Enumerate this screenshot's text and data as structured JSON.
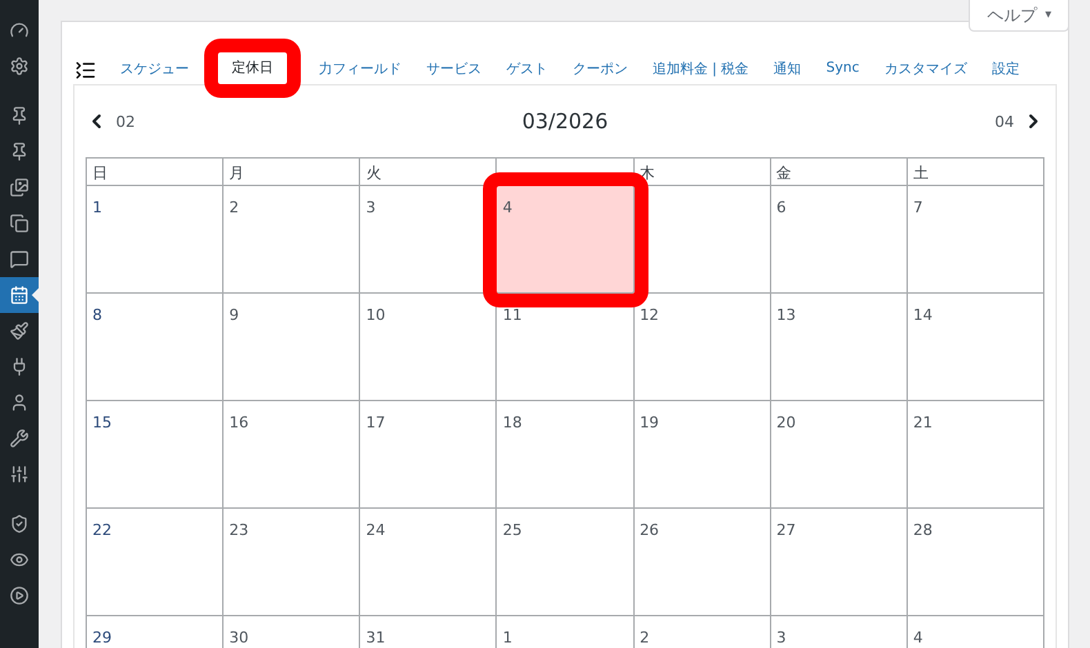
{
  "sidebar": {
    "items": [
      {
        "selected": false
      },
      {
        "selected": false
      },
      {
        "selected": false
      },
      {
        "selected": false
      },
      {
        "selected": false
      },
      {
        "selected": false
      },
      {
        "selected": false
      },
      {
        "selected": true
      },
      {
        "selected": false
      },
      {
        "selected": false
      },
      {
        "selected": false
      },
      {
        "selected": false
      },
      {
        "selected": false
      },
      {
        "selected": false
      },
      {
        "selected": false
      },
      {
        "selected": false
      }
    ]
  },
  "help": {
    "label": "ヘルプ",
    "caret": "▾"
  },
  "tabs": [
    {
      "label": "スケジュー",
      "selected": false,
      "highlighted": false
    },
    {
      "label": "定休日",
      "selected": true,
      "highlighted": true
    },
    {
      "label": "力フィールド",
      "selected": false,
      "highlighted": false
    },
    {
      "label": "サービス",
      "selected": false,
      "highlighted": false
    },
    {
      "label": "ゲスト",
      "selected": false,
      "highlighted": false
    },
    {
      "label": "クーポン",
      "selected": false,
      "highlighted": false
    },
    {
      "label": "追加料金 | 税金",
      "selected": false,
      "highlighted": false
    },
    {
      "label": "通知",
      "selected": false,
      "highlighted": false
    },
    {
      "label": "Sync",
      "selected": false,
      "highlighted": false
    },
    {
      "label": "カスタマイズ",
      "selected": false,
      "highlighted": false
    },
    {
      "label": "設定",
      "selected": false,
      "highlighted": false
    }
  ],
  "calendar": {
    "prev": "02",
    "title": "03/2026",
    "next": "04",
    "weekdays": [
      {
        "label": "日",
        "covered": false
      },
      {
        "label": "月",
        "covered": false
      },
      {
        "label": "火",
        "covered": false
      },
      {
        "covered": true
      },
      {
        "label": "木",
        "covered": false
      },
      {
        "label": "金",
        "covered": false
      },
      {
        "label": "土",
        "covered": false
      }
    ],
    "weeks": [
      [
        {
          "day": "1",
          "highlighted": false
        },
        {
          "day": "2",
          "highlighted": false
        },
        {
          "day": "3",
          "highlighted": false
        },
        {
          "day": "4",
          "highlighted": true
        },
        {
          "highlighted": false
        },
        {
          "day": "6",
          "highlighted": false
        },
        {
          "day": "7",
          "highlighted": false
        }
      ],
      [
        {
          "day": "8",
          "highlighted": false
        },
        {
          "day": "9",
          "highlighted": false
        },
        {
          "day": "10",
          "highlighted": false
        },
        {
          "day": "11",
          "highlighted": false
        },
        {
          "day": "12",
          "highlighted": false
        },
        {
          "day": "13",
          "highlighted": false
        },
        {
          "day": "14",
          "highlighted": false
        }
      ],
      [
        {
          "day": "15",
          "highlighted": false
        },
        {
          "day": "16",
          "highlighted": false
        },
        {
          "day": "17",
          "highlighted": false
        },
        {
          "day": "18",
          "highlighted": false
        },
        {
          "day": "19",
          "highlighted": false
        },
        {
          "day": "20",
          "highlighted": false
        },
        {
          "day": "21",
          "highlighted": false
        }
      ],
      [
        {
          "day": "22",
          "highlighted": false
        },
        {
          "day": "23",
          "highlighted": false
        },
        {
          "day": "24",
          "highlighted": false
        },
        {
          "day": "25",
          "highlighted": false
        },
        {
          "day": "26",
          "highlighted": false
        },
        {
          "day": "27",
          "highlighted": false
        },
        {
          "day": "28",
          "highlighted": false
        }
      ],
      [
        {
          "day": "29",
          "highlighted": false
        },
        {
          "day": "30",
          "highlighted": false
        },
        {
          "day": "31",
          "highlighted": false
        },
        {
          "day": "1",
          "highlighted": false
        },
        {
          "day": "2",
          "highlighted": false
        },
        {
          "day": "3",
          "highlighted": false
        },
        {
          "day": "4",
          "highlighted": false
        }
      ]
    ]
  }
}
